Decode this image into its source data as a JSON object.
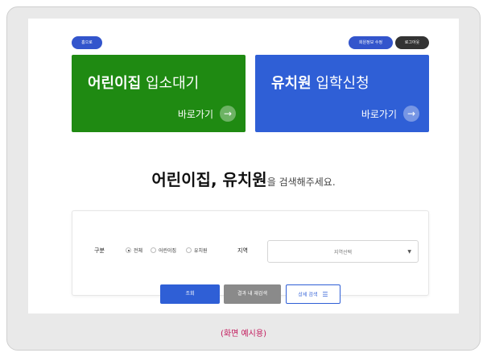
{
  "nav": {
    "home": "홈으로",
    "edit_member": "회원정보 수정",
    "logout": "로그아웃"
  },
  "cards": [
    {
      "title_bold": "어린이집",
      "title_light": "입소대기",
      "go": "바로가기",
      "color": "#1f8a12"
    },
    {
      "title_bold": "유치원",
      "title_light": "입학신청",
      "go": "바로가기",
      "color": "#2f5fd6"
    }
  ],
  "headline": {
    "bold": "어린이집, 유치원",
    "rest": "을 검색해주세요."
  },
  "search": {
    "category_label": "구분",
    "options": [
      "전체",
      "어린이집",
      "유치원"
    ],
    "selected_option": "전체",
    "region_label": "지역",
    "region_placeholder": "지역선택"
  },
  "buttons": {
    "search": "조회",
    "within": "결과 내 재검색",
    "detail": "상세 검색"
  },
  "caption": "(화면 예시용)",
  "icons": {
    "arrow": "arrow-right-icon",
    "caret": "caret-down-icon",
    "filter": "filter-lines-icon"
  }
}
